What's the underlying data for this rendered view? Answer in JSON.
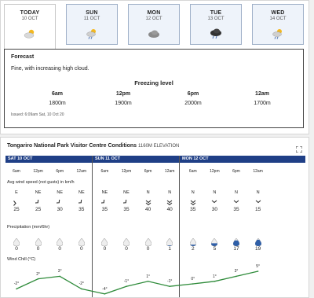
{
  "tabs": [
    {
      "day": "TODAY",
      "date": "10 OCT",
      "icon": "partly-cloudy-icon",
      "active": true
    },
    {
      "day": "SUN",
      "date": "11 OCT",
      "icon": "sun-cloud-rain-icon",
      "active": false
    },
    {
      "day": "MON",
      "date": "12 OCT",
      "icon": "cloud-icon",
      "active": false
    },
    {
      "day": "TUE",
      "date": "13 OCT",
      "icon": "dark-cloud-icon",
      "active": false
    },
    {
      "day": "WED",
      "date": "14 OCT",
      "icon": "sun-cloud-rain-icon",
      "active": false
    }
  ],
  "forecast": {
    "title": "Forecast",
    "text": "Fine, with increasing high cloud.",
    "freezing_title": "Freezing level",
    "levels": [
      {
        "time": "6am",
        "value": "1800m"
      },
      {
        "time": "12pm",
        "value": "1900m"
      },
      {
        "time": "6pm",
        "value": "2000m"
      },
      {
        "time": "12am",
        "value": "1700m"
      }
    ],
    "issued": "Issued: 6:09am Sat, 10 Oct 20"
  },
  "conditions": {
    "title": "Tongariro National Park Visitor Centre Conditions",
    "elevation": "1160M ELEVATION",
    "days": [
      "SAT 10 OCT",
      "SUN 11 OCT",
      "MON 12 OCT"
    ],
    "times": [
      "6am",
      "12pm",
      "6pm",
      "12am",
      "6am",
      "12pm",
      "6pm",
      "12am",
      "6am",
      "12pm",
      "6pm",
      "12am"
    ],
    "wind_label": "Avg wind speed (not gusts) in km/h",
    "wind_dir": [
      "E",
      "NE",
      "NE",
      "NE",
      "NE",
      "NE",
      "N",
      "N",
      "N",
      "N",
      "N",
      "N"
    ],
    "wind_strength": [
      1,
      1,
      1,
      1,
      1,
      1,
      2,
      2,
      2,
      1,
      1,
      1
    ],
    "wind_speed": [
      "25",
      "25",
      "30",
      "35",
      "35",
      "35",
      "40",
      "40",
      "35",
      "30",
      "35",
      "15"
    ],
    "precip_label": "Precipitation (mm/6hr)",
    "precip": [
      "0",
      "0",
      "0",
      "0",
      "0",
      "0",
      "0",
      "1",
      "2",
      "5",
      "17",
      "19"
    ],
    "precip_fill": [
      0,
      0,
      0,
      0,
      0,
      0,
      0,
      0.1,
      0.2,
      0.4,
      0.8,
      0.9
    ],
    "windchill_label": "Wind Chill (°C)",
    "windchill_text": [
      "-2°",
      "2°",
      "3°",
      "-2°",
      "-4°",
      "-1°",
      "1°",
      "-1°",
      "0°",
      "1°",
      "3°",
      "5°"
    ],
    "windchill": [
      -2,
      2,
      3,
      -2,
      -4,
      -1,
      1,
      -1,
      0,
      1,
      3,
      5
    ]
  }
}
